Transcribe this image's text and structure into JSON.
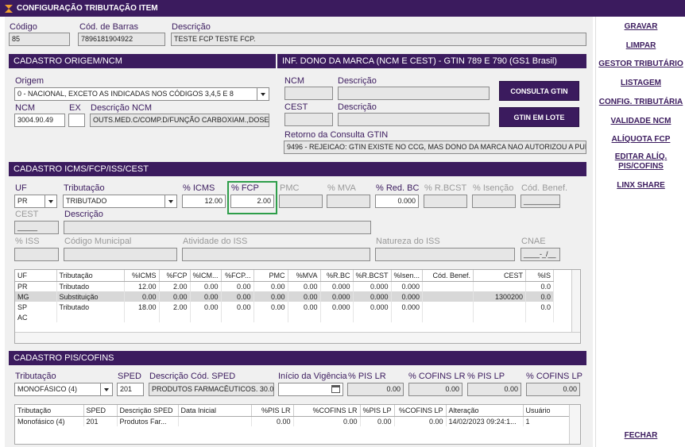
{
  "window_title": "CONFIGURAÇÃO TRIBUTAÇÃO ITEM",
  "header": {
    "codigo_label": "Código",
    "codigo_value": "85",
    "barras_label": "Cód. de Barras",
    "barras_value": "7896181904922",
    "descricao_label": "Descrição",
    "descricao_value": "TESTE FCP TESTE FCP."
  },
  "origem_section": {
    "title": "CADASTRO ORIGEM/NCM",
    "origem_label": "Origem",
    "origem_value": "0 - NACIONAL, EXCETO AS INDICADAS NOS CÓDIGOS 3,4,5 E 8",
    "ncm_label": "NCM",
    "ncm_value": "3004.90.49",
    "ex_label": "EX",
    "ex_value": "",
    "desc_ncm_label": "Descrição NCM",
    "desc_ncm_value": "OUTS.MED.C/COMP.D/FUNÇÃO CARBOXIAM.,DOSES"
  },
  "marca_section": {
    "title": "INF. DONO DA MARCA (NCM E CEST) - GTIN 789 E 790 (GS1 Brasil)",
    "ncm_label": "NCM",
    "descricao_label": "Descrição",
    "cest_label": "CEST",
    "descricao2_label": "Descrição",
    "consulta_button": "CONSULTA GTIN",
    "lote_button": "GTIN EM LOTE",
    "retorno_label": "Retorno da Consulta GTIN",
    "retorno_value": "9496 - REJEICAO: GTIN EXISTE NO CCG, MAS DONO DA MARCA NAO AUTORIZOU A PUBL"
  },
  "icms_section": {
    "title": "CADASTRO ICMS/FCP/ISS/CEST",
    "uf_label": "UF",
    "uf_value": "PR",
    "trib_label": "Tributação",
    "trib_value": "TRIBUTADO",
    "icms_label": "% ICMS",
    "icms_value": "12.00",
    "fcp_label": "% FCP",
    "fcp_value": "2.00",
    "pmc_label": "PMC",
    "mva_label": "% MVA",
    "redbc_label": "% Red. BC",
    "redbc_value": "0.000",
    "rbcst_label": "% R.BCST",
    "isencao_label": "% Isenção",
    "codbenef_label": "Cód. Benef.",
    "codbenef_value": "_________",
    "cest_label": "CEST",
    "cest_value": "_____",
    "descricao_label": "Descrição",
    "iss_label": "% ISS",
    "codmun_label": "Código Municipal",
    "ativ_label": "Atividade do ISS",
    "natureza_label": "Natureza do ISS",
    "cnae_label": "CNAE",
    "cnae_value": "____-_/__"
  },
  "icms_grid": {
    "headers": [
      "UF",
      "Tributação",
      "%ICMS",
      "%FCP",
      "%ICM...",
      "%FCP...",
      "PMC",
      "%MVA",
      "%R.BC",
      "%R.BCST",
      "%Isen...",
      "Cód. Benef.",
      "CEST",
      "%IS"
    ],
    "rows": [
      [
        "PR",
        "Tributado",
        "12.00",
        "2.00",
        "0.00",
        "0.00",
        "0.00",
        "0.00",
        "0.000",
        "0.000",
        "0.000",
        "",
        "",
        "0.0"
      ],
      [
        "MG",
        "Substituição",
        "0.00",
        "0.00",
        "0.00",
        "0.00",
        "0.00",
        "0.00",
        "0.000",
        "0.000",
        "0.000",
        "",
        "1300200",
        "0.0"
      ],
      [
        "SP",
        "Tributado",
        "18.00",
        "2.00",
        "0.00",
        "0.00",
        "0.00",
        "0.00",
        "0.000",
        "0.000",
        "0.000",
        "",
        "",
        "0.0"
      ],
      [
        "AC",
        "",
        "",
        "",
        "",
        "",
        "",
        "",
        "",
        "",
        "",
        "",
        "",
        ""
      ]
    ]
  },
  "pis_section": {
    "title": "CADASTRO PIS/COFINS",
    "trib_label": "Tributação",
    "trib_value": "MONOFÁSICO (4)",
    "sped_label": "SPED",
    "sped_value": "201",
    "descsped_label": "Descrição Cód. SPED",
    "descsped_value": "PRODUTOS FARMACÊUTICOS. 30.01, 3",
    "vigencia_label": "Início da Vigência",
    "vigencia_value": "",
    "pislr_label": "% PIS LR",
    "pislr_value": "0.00",
    "cofinslr_label": "% COFINS LR",
    "cofinslr_value": "0.00",
    "pislp_label": "% PIS LP",
    "pislp_value": "0.00",
    "cofinslp_label": "% COFINS LP",
    "cofinslp_value": "0.00"
  },
  "pis_grid": {
    "headers": [
      "Tributação",
      "SPED",
      "Descrição SPED",
      "Data Inicial",
      "%PIS LR",
      "%COFINS LR",
      "%PIS LP",
      "%COFINS LP",
      "Alteração",
      "Usuário"
    ],
    "rows": [
      [
        "Monofásico (4)",
        "201",
        "Produtos Far...",
        "",
        "0.00",
        "0.00",
        "0.00",
        "0.00",
        "14/02/2023 09:24:1...",
        "1"
      ]
    ]
  },
  "sidebar": {
    "gravar": "GRAVAR",
    "limpar": "LIMPAR",
    "gestor": "GESTOR TRIBUTÁRIO",
    "listagem": "LISTAGEM",
    "config": "CONFIG. TRIBUTÁRIA",
    "validade": "VALIDADE NCM",
    "aliquota": "ALÍQUOTA FCP",
    "editar1": "EDITAR ALÍQ.",
    "editar2": "PIS/COFINS",
    "linx": "LINX SHARE",
    "fechar": "FECHAR"
  }
}
